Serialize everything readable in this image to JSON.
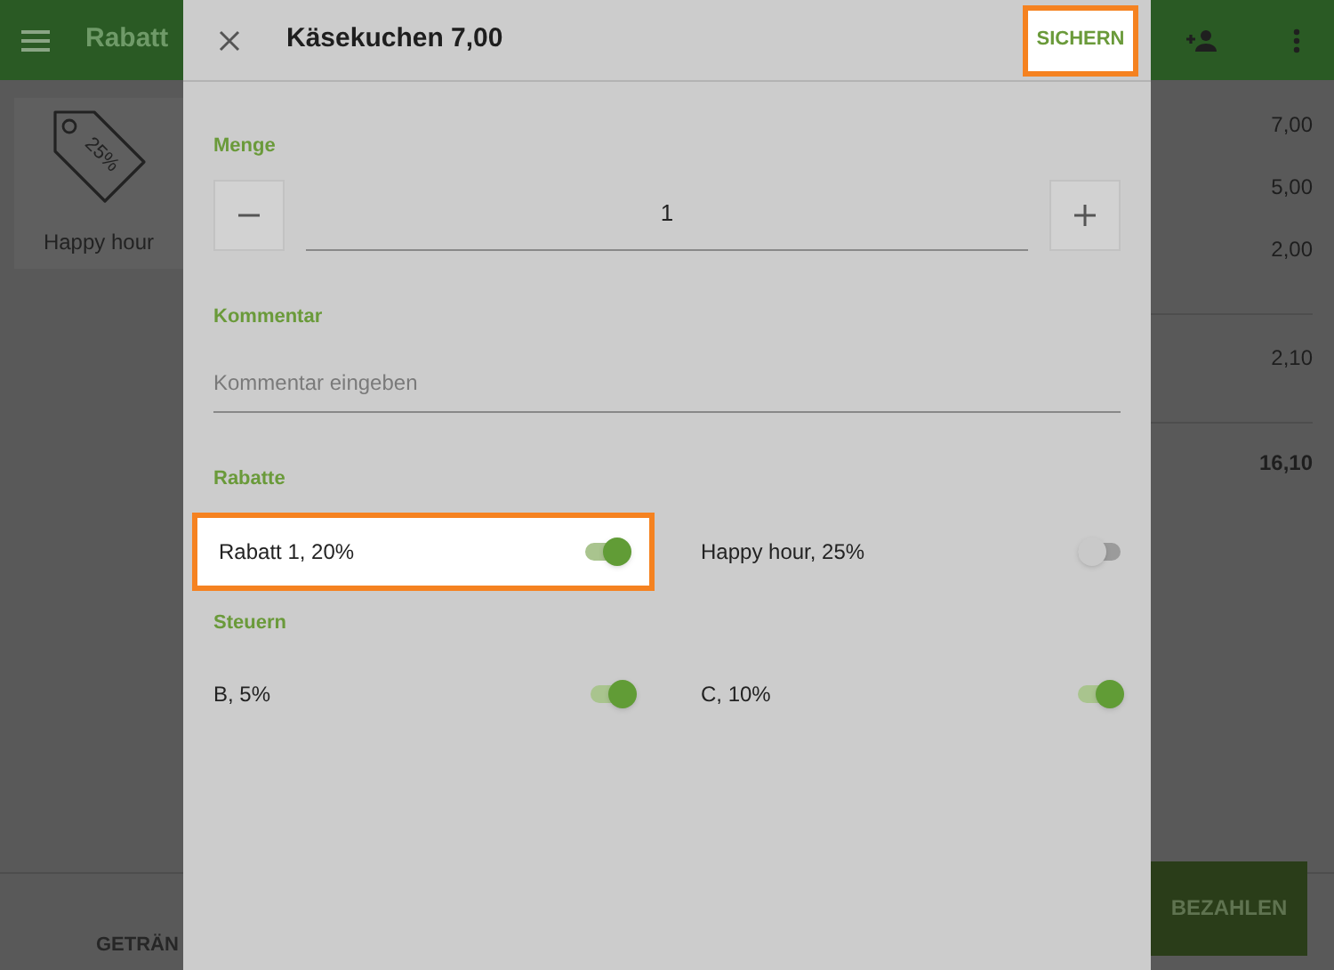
{
  "app": {
    "title": "Rabatt",
    "discount_card": {
      "badge": "25%",
      "label": "Happy hour"
    },
    "amount_groups": [
      [
        "7,00",
        "5,00",
        "2,00"
      ],
      [
        "2,10"
      ]
    ],
    "total": "16,10",
    "category_tab": "GETRÄN",
    "pay_button": "BEZAHLEN"
  },
  "dialog": {
    "title": "Käsekuchen 7,00",
    "save_button": {
      "label": "SICHERN",
      "highlighted": true
    },
    "quantity": {
      "label": "Menge",
      "value": "1"
    },
    "comment": {
      "label": "Kommentar",
      "placeholder": "Kommentar eingeben"
    },
    "sections": [
      {
        "title": "Rabatte",
        "toggles": [
          {
            "label": "Rabatt 1, 20%",
            "on": true,
            "highlighted": true
          },
          {
            "label": "Happy hour, 25%",
            "on": false,
            "highlighted": false
          }
        ]
      },
      {
        "title": "Steuern",
        "toggles": [
          {
            "label": "B, 5%",
            "on": true,
            "highlighted": false
          },
          {
            "label": "C, 10%",
            "on": true,
            "highlighted": false
          }
        ]
      }
    ]
  }
}
